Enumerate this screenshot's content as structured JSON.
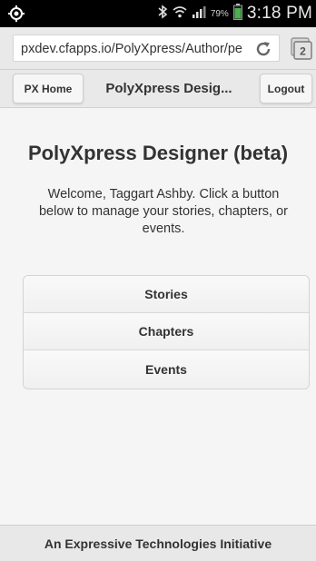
{
  "status_bar": {
    "battery_percent": "79%",
    "time": "3:18 PM",
    "icons": [
      "gps-icon",
      "bluetooth-icon",
      "wifi-icon",
      "signal-icon",
      "battery-icon"
    ]
  },
  "browser": {
    "url": "pxdev.cfapps.io/PolyXpress/Author/pe",
    "tab_count": "2"
  },
  "header": {
    "home_label": "PX Home",
    "title": "PolyXpress Desig...",
    "logout_label": "Logout"
  },
  "main": {
    "title": "PolyXpress Designer (beta)",
    "description": "Welcome, Taggart Ashby. Click a button below to manage your stories, chapters, or events.",
    "buttons": [
      "Stories",
      "Chapters",
      "Events"
    ]
  },
  "footer": {
    "text": "An Expressive Technologies Initiative"
  },
  "colors": {
    "battery": "#4caf50",
    "status_bar_bg": "#000000",
    "toolbar_bg": "#e9e9e9"
  }
}
